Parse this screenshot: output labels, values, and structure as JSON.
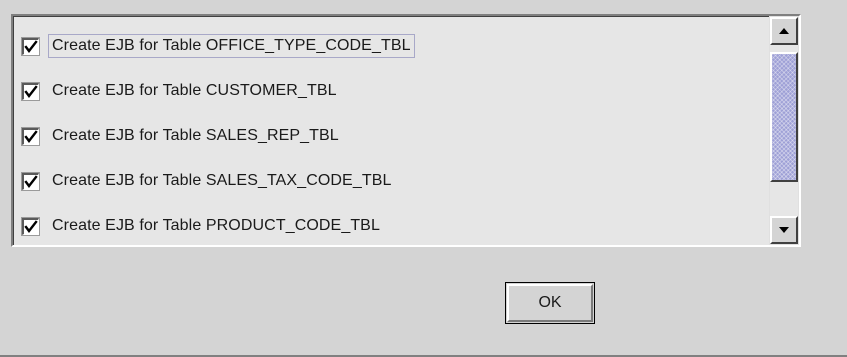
{
  "list": {
    "items": [
      {
        "label": "Create EJB for Table OFFICE_TYPE_CODE_TBL",
        "checked": true,
        "focused": true
      },
      {
        "label": "Create EJB for Table CUSTOMER_TBL",
        "checked": true,
        "focused": false
      },
      {
        "label": "Create EJB for Table SALES_REP_TBL",
        "checked": true,
        "focused": false
      },
      {
        "label": "Create EJB for Table SALES_TAX_CODE_TBL",
        "checked": true,
        "focused": false
      },
      {
        "label": "Create EJB for Table PRODUCT_CODE_TBL",
        "checked": true,
        "focused": false
      }
    ]
  },
  "scrollbar": {
    "up_icon": "arrow-up-icon",
    "down_icon": "arrow-down-icon",
    "thumb_color": "#9ea0d6"
  },
  "buttons": {
    "ok_label": "OK"
  },
  "colors": {
    "background": "#d4d4d4",
    "list_background": "#e6e6e6"
  }
}
